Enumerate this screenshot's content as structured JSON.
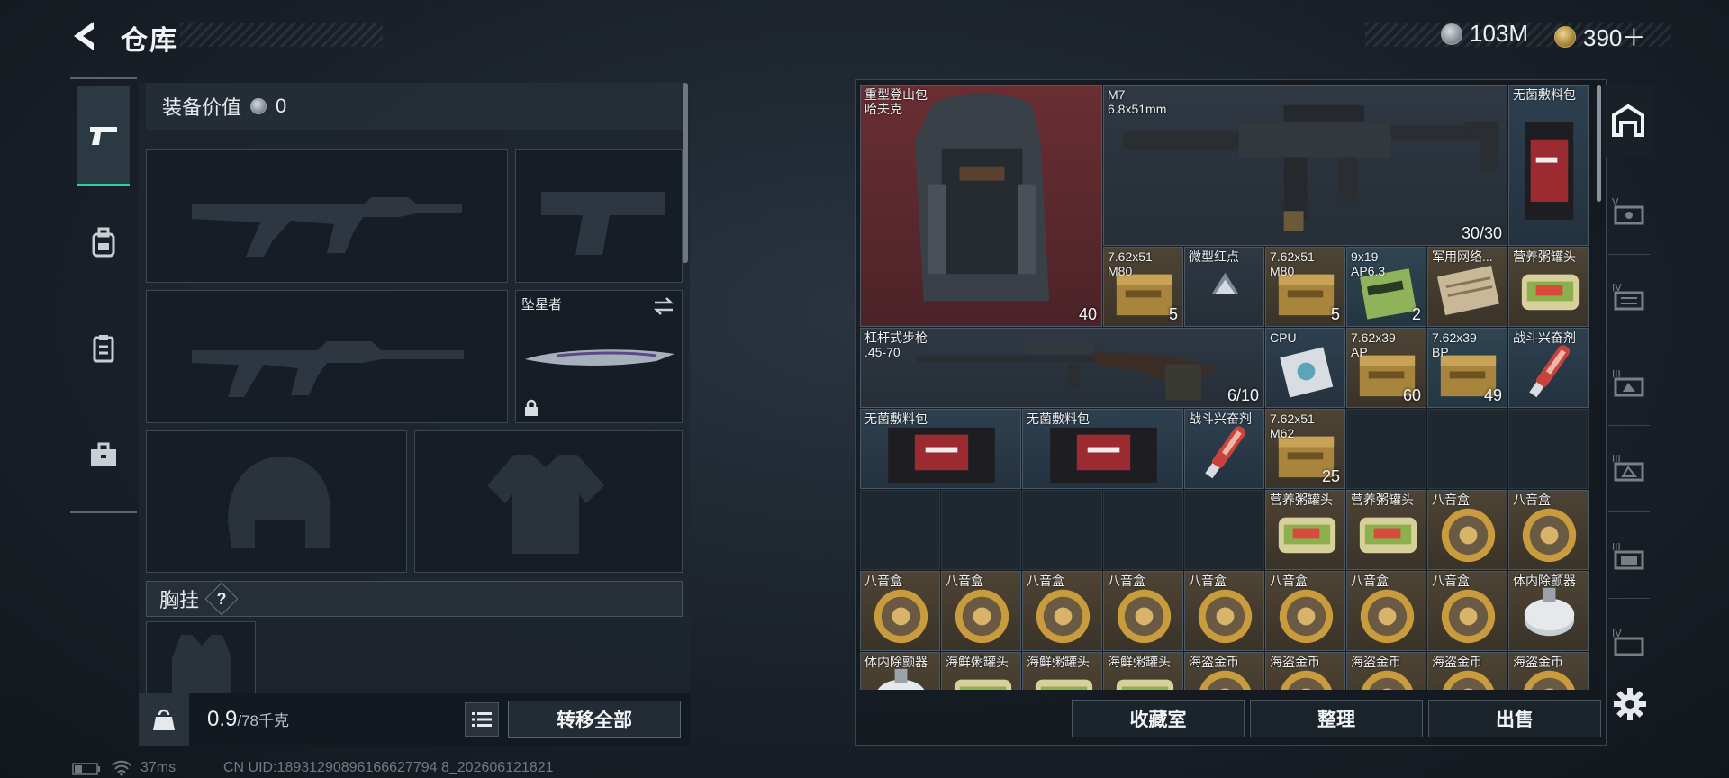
{
  "header": {
    "title": "仓库",
    "currency_silver": "103M",
    "currency_gold": "390＋"
  },
  "equipment": {
    "value_label": "装备价值",
    "value": "0",
    "melee_label": "坠星者",
    "chest_rig_label": "胸挂",
    "help": "?"
  },
  "footer_left": {
    "weight_current": "0.9",
    "weight_max": "/78千克",
    "transfer_all": "转移全部"
  },
  "stash": {
    "items": [
      {
        "id": "backpack",
        "name": "重型登山包\n哈夫克",
        "qty": "40",
        "color": "red"
      },
      {
        "id": "m7",
        "name": "M7\n6.8x51mm",
        "qty": "30/30",
        "color": "grey"
      },
      {
        "id": "bandage1",
        "name": "无菌敷料包",
        "qty": "",
        "color": "blue"
      },
      {
        "id": "ammo1",
        "name": "7.62x51\nM80",
        "qty": "5",
        "color": "brown"
      },
      {
        "id": "reddot",
        "name": "微型红点",
        "qty": "",
        "color": "grey"
      },
      {
        "id": "ammo2",
        "name": "7.62x51\nM80",
        "qty": "5",
        "color": "brown"
      },
      {
        "id": "ammo3",
        "name": "9x19\nAP6.3",
        "qty": "2",
        "color": "teal"
      },
      {
        "id": "netcard",
        "name": "军用网络...",
        "qty": "",
        "color": "brown"
      },
      {
        "id": "can1",
        "name": "营养粥罐头",
        "qty": "",
        "color": "brown"
      },
      {
        "id": "leverrifle",
        "name": "杠杆式步枪\n.45-70",
        "qty": "6/10",
        "color": "grey"
      },
      {
        "id": "cpu",
        "name": "CPU",
        "qty": "",
        "color": "blue"
      },
      {
        "id": "ammo4",
        "name": "7.62x39\nAP",
        "qty": "60",
        "color": "brown"
      },
      {
        "id": "ammo5",
        "name": "7.62x39\nBP",
        "qty": "49",
        "color": "teal"
      },
      {
        "id": "stim1",
        "name": "战斗兴奋剂",
        "qty": "",
        "color": "blue"
      },
      {
        "id": "bandage2",
        "name": "无菌敷料包",
        "qty": "",
        "color": "blue"
      },
      {
        "id": "bandage3",
        "name": "无菌敷料包",
        "qty": "",
        "color": "blue"
      },
      {
        "id": "stim2",
        "name": "战斗兴奋剂",
        "qty": "",
        "color": "blue"
      },
      {
        "id": "ammo6",
        "name": "7.62x51\nM62",
        "qty": "25",
        "color": "brown"
      },
      {
        "id": "can2",
        "name": "营养粥罐头",
        "qty": "",
        "color": "brown"
      },
      {
        "id": "can3",
        "name": "营养粥罐头",
        "qty": "",
        "color": "brown"
      },
      {
        "id": "musicbox1",
        "name": "八音盒",
        "qty": "",
        "color": "brown"
      },
      {
        "id": "musicbox2",
        "name": "八音盒",
        "qty": "",
        "color": "brown"
      },
      {
        "id": "musicbox3",
        "name": "八音盒",
        "qty": "",
        "color": "brown"
      },
      {
        "id": "musicbox4",
        "name": "八音盒",
        "qty": "",
        "color": "brown"
      },
      {
        "id": "musicbox5",
        "name": "八音盒",
        "qty": "",
        "color": "brown"
      },
      {
        "id": "musicbox6",
        "name": "八音盒",
        "qty": "",
        "color": "brown"
      },
      {
        "id": "musicbox7",
        "name": "八音盒",
        "qty": "",
        "color": "brown"
      },
      {
        "id": "musicbox8",
        "name": "八音盒",
        "qty": "",
        "color": "brown"
      },
      {
        "id": "musicbox9",
        "name": "八音盒",
        "qty": "",
        "color": "brown"
      },
      {
        "id": "musicbox10",
        "name": "八音盒",
        "qty": "",
        "color": "brown"
      },
      {
        "id": "dehumid1",
        "name": "体内除颤器",
        "qty": "",
        "color": "brown"
      },
      {
        "id": "dehumid2",
        "name": "体内除颤器",
        "qty": "",
        "color": "brown"
      },
      {
        "id": "seafood1",
        "name": "海鲜粥罐头",
        "qty": "",
        "color": "brown"
      },
      {
        "id": "seafood2",
        "name": "海鲜粥罐头",
        "qty": "",
        "color": "brown"
      },
      {
        "id": "seafood3",
        "name": "海鲜粥罐头",
        "qty": "",
        "color": "brown"
      },
      {
        "id": "pirate1",
        "name": "海盗金币",
        "qty": "",
        "color": "brown"
      },
      {
        "id": "pirate2",
        "name": "海盗金币",
        "qty": "",
        "color": "brown"
      },
      {
        "id": "pirate3",
        "name": "海盗金币",
        "qty": "",
        "color": "brown"
      },
      {
        "id": "pirate4",
        "name": "海盗金币",
        "qty": "",
        "color": "brown"
      },
      {
        "id": "pirate5",
        "name": "海盗金币",
        "qty": "",
        "color": "brown"
      }
    ]
  },
  "footer_right": {
    "collection": "收藏室",
    "sort": "整理",
    "sell": "出售"
  },
  "status": {
    "ping": "37ms",
    "uid": "CN UID:18931290896166627794 8_202606121821"
  },
  "icons": {
    "back": "chevron-left-icon",
    "rail": [
      "pistol-icon",
      "backpack-icon",
      "vest-icon",
      "toolbox-icon"
    ],
    "right_rail": [
      "warehouse-icon",
      "tier-v-icon",
      "tier-iv-icon",
      "tier-iii-icon",
      "tier-iii-b-icon",
      "tier-ii-icon",
      "tier-iv-b-icon",
      "gear-icon"
    ]
  },
  "colors": {
    "accent": "#2fd0a8",
    "item_red": "#6a2e33",
    "item_brown": "#4e4435",
    "item_blue": "#2e4050"
  }
}
